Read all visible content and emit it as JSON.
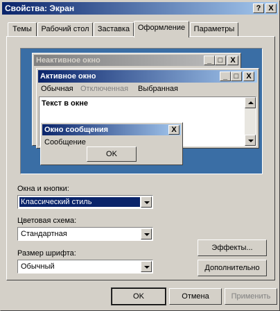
{
  "window": {
    "title": "Свойства: Экран",
    "help_btn": "?",
    "close_btn": "X"
  },
  "tabs": [
    "Темы",
    "Рабочий стол",
    "Заставка",
    "Оформление",
    "Параметры"
  ],
  "preview": {
    "inactive_title": "Неактивное окно",
    "active_title": "Активное окно",
    "menu": [
      "Обычная",
      "Отключенная",
      "Выбранная"
    ],
    "window_text": "Текст в окне",
    "msgbox_title": "Окно сообщения",
    "msgbox_text": "Сообщение",
    "msgbox_ok": "OK",
    "min": "_",
    "max": "□",
    "close": "X"
  },
  "fields": {
    "windows_buttons_label": "Окна и кнопки:",
    "windows_buttons_value": "Классический стиль",
    "color_scheme_label": "Цветовая схема:",
    "color_scheme_value": "Стандартная",
    "font_size_label": "Размер шрифта:",
    "font_size_value": "Обычный"
  },
  "buttons": {
    "effects": "Эффекты...",
    "advanced": "Дополнительно",
    "ok": "OK",
    "cancel": "Отмена",
    "apply": "Применить"
  },
  "colors": {
    "title_active": "#0a246a",
    "title_inactive": "#808080",
    "desktop": "#3a6ea5",
    "selection": "#0a246a"
  }
}
